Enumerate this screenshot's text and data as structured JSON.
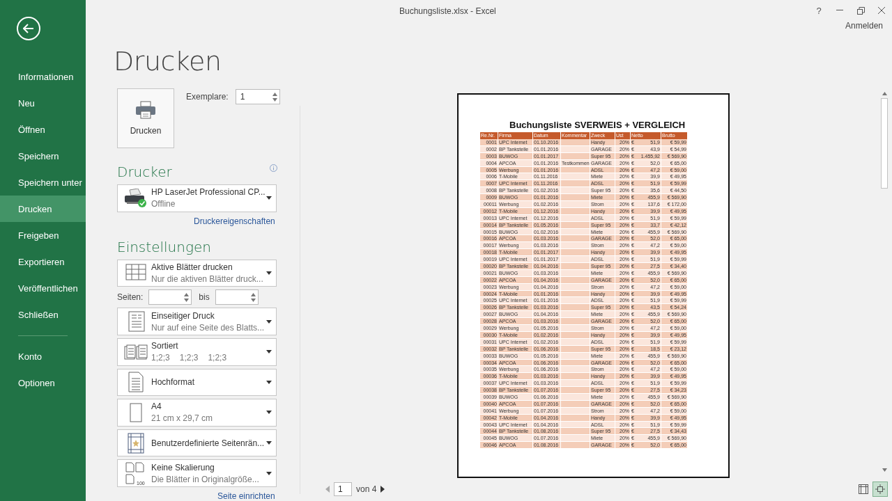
{
  "window": {
    "title": "Buchungsliste.xlsx - Excel",
    "help": "?",
    "account": "Anmelden"
  },
  "sidebar": {
    "items": [
      {
        "label": "Informationen",
        "selected": false
      },
      {
        "label": "Neu",
        "selected": false
      },
      {
        "label": "Öffnen",
        "selected": false
      },
      {
        "label": "Speichern",
        "selected": false
      },
      {
        "label": "Speichern unter",
        "selected": false
      },
      {
        "label": "Drucken",
        "selected": true
      },
      {
        "label": "Freigeben",
        "selected": false
      },
      {
        "label": "Exportieren",
        "selected": false
      },
      {
        "label": "Veröffentlichen",
        "selected": false
      },
      {
        "label": "Schließen",
        "selected": false
      }
    ],
    "bottom_items": [
      {
        "label": "Konto",
        "selected": false
      },
      {
        "label": "Optionen",
        "selected": false
      }
    ]
  },
  "heading": "Drucken",
  "print_button": "Drucken",
  "copies": {
    "label": "Exemplare:",
    "value": "1"
  },
  "printer": {
    "heading": "Drucker",
    "name": "HP LaserJet Professional CP...",
    "status": "Offline",
    "properties_link": "Druckereigenschaften"
  },
  "settings": {
    "heading": "Einstellungen",
    "pages": {
      "label": "Seiten:",
      "to_label": "bis"
    },
    "dropdowns": [
      {
        "kind": "sheets",
        "title": "Aktive Blätter drucken",
        "detail": "Nur die aktiven Blätter druck..."
      },
      {
        "kind": "sides",
        "title": "Einseitiger Druck",
        "detail": "Nur auf eine Seite des Blatts..."
      },
      {
        "kind": "collate",
        "title": "Sortiert",
        "details": [
          "1;2;3",
          "1;2;3",
          "1;2;3"
        ]
      },
      {
        "kind": "orientation",
        "title": "Hochformat"
      },
      {
        "kind": "paper",
        "title": "A4",
        "detail": "21  cm x 29,7  cm"
      },
      {
        "kind": "margins",
        "title": "Benutzerdefinierte Seitenrän..."
      },
      {
        "kind": "scaling",
        "title": "Keine Skalierung",
        "detail": "Die Blätter in Originalgröße...",
        "badge": "100"
      }
    ],
    "page_setup_link": "Seite einrichten"
  },
  "preview": {
    "title": "Buchungsliste SVERWEIS + VERGLEICH",
    "columns": [
      "Re.Nr.",
      "Firma",
      "Datum",
      "Kommentar",
      "Zweck",
      "Ust",
      "Netto",
      "Brutto"
    ],
    "rows": [
      [
        "0001",
        "UPC Internet",
        "01.10.2016",
        "",
        "Handy",
        "20%",
        "€ 51,9",
        "€ 59,99"
      ],
      [
        "0002",
        "BP Tankstelle",
        "01.01.2016",
        "",
        "GARAGE",
        "20%",
        "€ 43,9",
        "€ 54,99"
      ],
      [
        "0003",
        "BUWOG",
        "01.01.2017",
        "",
        "Super 95",
        "20%",
        "€ 1.455,92",
        "€ 569,90"
      ],
      [
        "0004",
        "APCOA",
        "01.01.2016",
        "Testkommen",
        "GARAGE",
        "20%",
        "€ 52,0",
        "€ 65,00"
      ],
      [
        "0005",
        "Werbung",
        "01.01.2016",
        "",
        "ADSL",
        "20%",
        "€ 47,2",
        "€ 59,00"
      ],
      [
        "0006",
        "T-Mobile",
        "01.11.2016",
        "",
        "Miete",
        "20%",
        "€ 39,9",
        "€ 49,95"
      ],
      [
        "0007",
        "UPC Internet",
        "01.11.2016",
        "",
        "ADSL",
        "20%",
        "€ 51,9",
        "€ 59,99"
      ],
      [
        "0008",
        "BP Tankstelle",
        "01.02.2016",
        "",
        "Super 95",
        "20%",
        "€ 35,6",
        "€ 44,50"
      ],
      [
        "0009",
        "BUWOG",
        "01.01.2016",
        "",
        "Miete",
        "20%",
        "€ 455,9",
        "€ 569,90"
      ],
      [
        "00011",
        "Werbung",
        "01.02.2016",
        "",
        "Strom",
        "20%",
        "€ 137,6",
        "€ 172,00"
      ],
      [
        "00012",
        "T-Mobile",
        "01.12.2016",
        "",
        "Handy",
        "20%",
        "€ 39,9",
        "€ 49,95"
      ],
      [
        "00013",
        "UPC Internet",
        "01.12.2016",
        "",
        "ADSL",
        "20%",
        "€ 51,9",
        "€ 59,99"
      ],
      [
        "00014",
        "BP Tankstelle",
        "01.05.2016",
        "",
        "Super 95",
        "20%",
        "€ 33,7",
        "€ 42,12"
      ],
      [
        "00015",
        "BUWOG",
        "01.02.2016",
        "",
        "Miete",
        "20%",
        "€ 455,9",
        "€ 569,90"
      ],
      [
        "00016",
        "APCOA",
        "01.03.2016",
        "",
        "GARAGE",
        "20%",
        "€ 52,0",
        "€ 65,00"
      ],
      [
        "00017",
        "Werbung",
        "01.03.2016",
        "",
        "Strom",
        "20%",
        "€ 47,2",
        "€ 59,00"
      ],
      [
        "00018",
        "T-Mobile",
        "01.01.2017",
        "",
        "Handy",
        "20%",
        "€ 39,9",
        "€ 49,95"
      ],
      [
        "00019",
        "UPC Internet",
        "01.01.2017",
        "",
        "ADSL",
        "20%",
        "€ 51,9",
        "€ 59,99"
      ],
      [
        "00020",
        "BP Tankstelle",
        "01.04.2016",
        "",
        "Super 95",
        "20%",
        "€ 27,5",
        "€ 34,40"
      ],
      [
        "00021",
        "BUWOG",
        "01.03.2016",
        "",
        "Miete",
        "20%",
        "€ 455,9",
        "€ 569,90"
      ],
      [
        "00022",
        "APCOA",
        "01.04.2016",
        "",
        "GARAGE",
        "20%",
        "€ 52,0",
        "€ 65,00"
      ],
      [
        "00023",
        "Werbung",
        "01.04.2016",
        "",
        "Strom",
        "20%",
        "€ 47,2",
        "€ 59,00"
      ],
      [
        "00024",
        "T-Mobile",
        "01.01.2016",
        "",
        "Handy",
        "20%",
        "€ 39,9",
        "€ 49,95"
      ],
      [
        "00025",
        "UPC Internet",
        "01.01.2016",
        "",
        "ADSL",
        "20%",
        "€ 51,9",
        "€ 59,99"
      ],
      [
        "00026",
        "BP Tankstelle",
        "01.03.2016",
        "",
        "Super 95",
        "20%",
        "€ 43,5",
        "€ 54,24"
      ],
      [
        "00027",
        "BUWOG",
        "01.04.2016",
        "",
        "Miete",
        "20%",
        "€ 455,9",
        "€ 569,90"
      ],
      [
        "00028",
        "APCOA",
        "01.03.2016",
        "",
        "GARAGE",
        "20%",
        "€ 52,0",
        "€ 65,00"
      ],
      [
        "00029",
        "Werbung",
        "01.05.2016",
        "",
        "Strom",
        "20%",
        "€ 47,2",
        "€ 59,00"
      ],
      [
        "00030",
        "T-Mobile",
        "01.02.2016",
        "",
        "Handy",
        "20%",
        "€ 39,9",
        "€ 49,95"
      ],
      [
        "00031",
        "UPC Internet",
        "01.02.2016",
        "",
        "ADSL",
        "20%",
        "€ 51,9",
        "€ 59,99"
      ],
      [
        "00032",
        "BP Tankstelle",
        "01.06.2016",
        "",
        "Super 95",
        "20%",
        "€ 18,5",
        "€ 23,12"
      ],
      [
        "00033",
        "BUWOG",
        "01.05.2016",
        "",
        "Miete",
        "20%",
        "€ 455,9",
        "€ 569,90"
      ],
      [
        "00034",
        "APCOA",
        "01.06.2016",
        "",
        "GARAGE",
        "20%",
        "€ 52,0",
        "€ 65,00"
      ],
      [
        "00035",
        "Werbung",
        "01.06.2016",
        "",
        "Strom",
        "20%",
        "€ 47,2",
        "€ 59,00"
      ],
      [
        "00036",
        "T-Mobile",
        "01.03.2016",
        "",
        "Handy",
        "20%",
        "€ 39,9",
        "€ 49,95"
      ],
      [
        "00037",
        "UPC Internet",
        "01.03.2016",
        "",
        "ADSL",
        "20%",
        "€ 51,9",
        "€ 59,99"
      ],
      [
        "00038",
        "BP Tankstelle",
        "01.07.2016",
        "",
        "Super 95",
        "20%",
        "€ 27,5",
        "€ 34,23"
      ],
      [
        "00039",
        "BUWOG",
        "01.06.2016",
        "",
        "Miete",
        "20%",
        "€ 455,9",
        "€ 569,90"
      ],
      [
        "00040",
        "APCOA",
        "01.07.2016",
        "",
        "GARAGE",
        "20%",
        "€ 52,0",
        "€ 65,00"
      ],
      [
        "00041",
        "Werbung",
        "01.07.2016",
        "",
        "Strom",
        "20%",
        "€ 47,2",
        "€ 59,00"
      ],
      [
        "00042",
        "T-Mobile",
        "01.04.2016",
        "",
        "Handy",
        "20%",
        "€ 39,9",
        "€ 49,95"
      ],
      [
        "00043",
        "UPC Internet",
        "01.04.2016",
        "",
        "ADSL",
        "20%",
        "€ 51,9",
        "€ 59,99"
      ],
      [
        "00044",
        "BP Tankstelle",
        "01.08.2016",
        "",
        "Super 95",
        "20%",
        "€ 27,5",
        "€ 34,43"
      ],
      [
        "00045",
        "BUWOG",
        "01.07.2016",
        "",
        "Miete",
        "20%",
        "€ 455,9",
        "€ 569,90"
      ],
      [
        "00046",
        "APCOA",
        "01.08.2016",
        "",
        "GARAGE",
        "20%",
        "€ 52,0",
        "€ 65,00"
      ]
    ]
  },
  "pager": {
    "page": "1",
    "of": "von 4"
  },
  "views": [
    {
      "kind": "margins",
      "selected": false
    },
    {
      "kind": "zoom",
      "selected": true
    }
  ]
}
